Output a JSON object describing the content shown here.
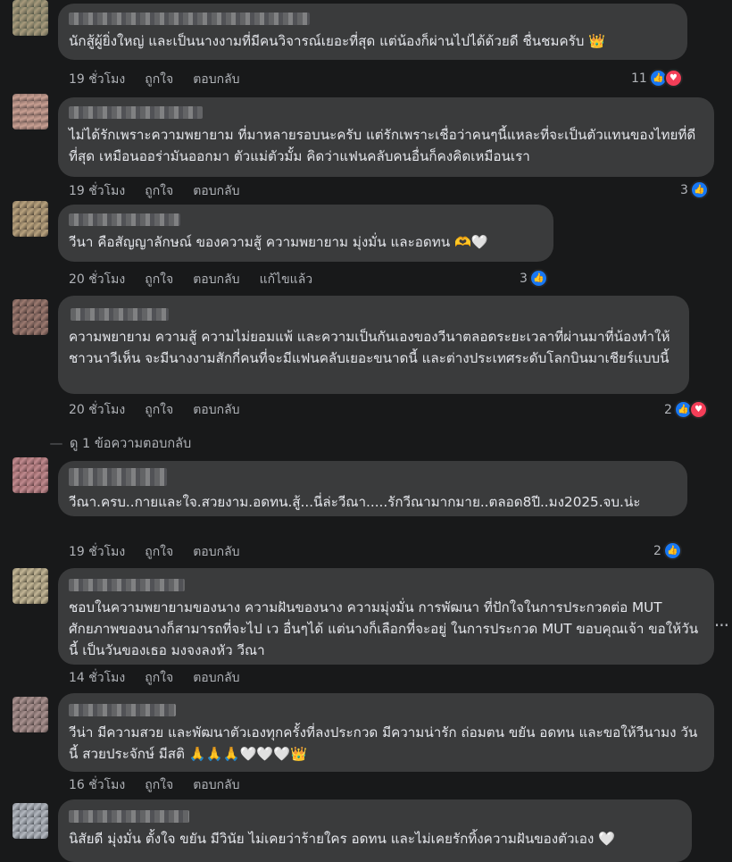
{
  "colors": {
    "background": "#18191a",
    "bubble": "#3a3b3c",
    "text": "#e4e6eb",
    "meta": "#b0b3b8",
    "like": "#1877f2",
    "love": "#f33e58"
  },
  "actions": {
    "like": "ถูกใจ",
    "reply": "ตอบกลับ",
    "edited": "แก้ไขแล้ว"
  },
  "comments": [
    {
      "text": "นักสู้ผู้ยิ่งใหญ่ และเป็นนางงามที่มีคนวิจารณ์เยอะที่สุด แต่น้องก็ผ่านไปได้ด้วยดี ชื่นชมครับ 👑",
      "time": "19 ชั่วโมง",
      "reaction_count": "11",
      "reactions": [
        "like-icon",
        "love-icon"
      ]
    },
    {
      "text": "ไม่ได้รักเพราะความพยายาม ที่มาหลายรอบนะครับ แต่รักเพราะเชื่อว่าคนๆนี้แหละที่จะเป็นตัวแทนของไทยที่ดีที่สุด เหมือนออร่ามันออกมา ตัวแม่ตัวมั้ม คิดว่าแฟนคลับคนอื่นก็คงคิดเหมือนเรา",
      "time": "19 ชั่วโมง",
      "reaction_count": "3",
      "reactions": [
        "like-icon"
      ]
    },
    {
      "text": "วีนา คือสัญญาลักษณ์ ของความสู้ ความพยายาม มุ่งมั่น และอดทน 🫶🤍",
      "time": "20 ชั่วโมง",
      "edited": true,
      "reaction_count": "3",
      "reactions": [
        "like-icon"
      ]
    },
    {
      "text": "ความพยายาม ความสู้ ความไม่ยอมแพ้ และความเป็นกันเองของวีนาตลอดระยะเวลาที่ผ่านมาที่น้องทำให้ชาวนาวีเห็น จะมีนางงามสักกี่คนที่จะมีแฟนคลับเยอะขนาดนี้ และต่างประเทศระดับโลกบินมาเชียร์แบบนี้",
      "time": "20 ชั่วโมง",
      "reaction_count": "2",
      "reactions": [
        "like-icon",
        "love-icon"
      ],
      "view_replies": "ดู 1 ข้อความตอบกลับ"
    },
    {
      "text": "วีณา.ครบ..กายและใจ.สวยงาม.อดทน.สู้...นี่ล่ะวีณา.....รักวีณามากมาย..ตลอด8ปี..มง2025.จบ.น่ะ",
      "time": "19 ชั่วโมง",
      "reaction_count": "2",
      "reactions": [
        "like-icon"
      ]
    },
    {
      "text": "ชอบในความพยายามของนาง ความฝันของนาง ความมุ่งมั่น การพัฒนา ที่ปักใจในการประกวดต่อ MUT ศักยภาพของนางก็สามารถที่จะไป เว อื่นๆได้ แต่นางก็เลือกที่จะอยู่ ในการประกวด MUT ขอบคุณเจ้า ขอให้วันนี้ เป็นวันของเธอ มงจงลงหัว วีณา",
      "time": "14 ชั่วโมง",
      "more": "···"
    },
    {
      "text": "วีน่า มีความสวย และพัฒนาตัวเองทุกครั้งที่ลงประกวด มีความน่ารัก ถ่อมตน ขยัน อดทน และขอให้วีนามง วันนี้ สวยประจักษ์ มีสติ 🙏🙏🙏🤍🤍🤍👑",
      "time": "16 ชั่วโมง"
    },
    {
      "text": "นิสัยดี มุ่งมั่น ตั้งใจ ขยัน มีวินัย ไม่เคยว่าร้ายใคร อดทน และไม่เคยรักทิ้งความฝันของตัวเอง 🤍",
      "time": ""
    }
  ]
}
